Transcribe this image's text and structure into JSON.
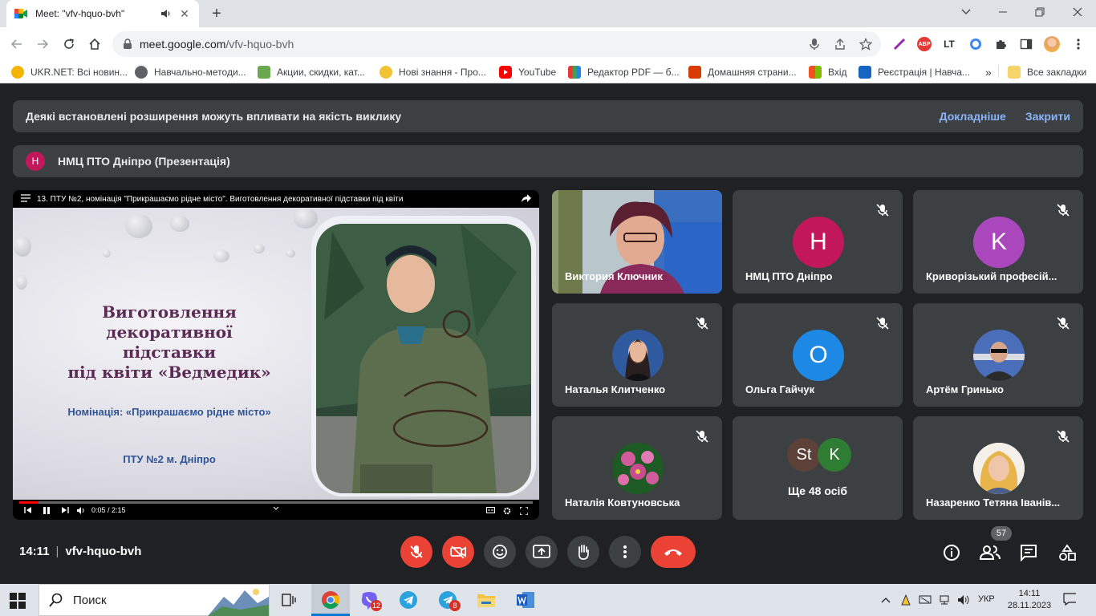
{
  "browser": {
    "tab_title": "Meet: \"vfv-hquo-bvh\"",
    "url_host": "meet.google.com",
    "url_path": "/vfv-hquo-bvh",
    "extensions": [
      "abp-badge-icon",
      "lt-icon",
      "circle-icon",
      "puzzle-icon",
      "sidepanel-icon",
      "profile-avatar"
    ],
    "abp_label": "ABP",
    "lt_label": "LT",
    "bookmarks": [
      {
        "label": "UKR.NET: Всі новин...",
        "icon": "sun-icon",
        "color": "#f4b400"
      },
      {
        "label": "Навчально-методи...",
        "icon": "globe-icon",
        "color": "#5f6368"
      },
      {
        "label": "Акции, скидки, кат...",
        "icon": "shop-icon",
        "color": "#6aa84f"
      },
      {
        "label": "Нові знання - Про...",
        "icon": "bulb-icon",
        "color": "#f1c232"
      },
      {
        "label": "YouTube",
        "icon": "youtube-icon",
        "color": "#ff0000"
      },
      {
        "label": "Редактор PDF — б...",
        "icon": "pdf-icon",
        "color": "#8e44ad"
      },
      {
        "label": "Домашняя страни...",
        "icon": "office-icon",
        "color": "#d83b01"
      },
      {
        "label": "Вхід",
        "icon": "windows-icon",
        "color": "#00a4ef"
      },
      {
        "label": "Реєстрація | Навча...",
        "icon": "eagle-icon",
        "color": "#1565c0"
      }
    ],
    "more_bookmarks": "»",
    "all_bookmarks": "Все закладки"
  },
  "meet": {
    "banner_text": "Деякі встановлені розширення можуть впливати на якість виклику",
    "banner_more": "Докладніше",
    "banner_close": "Закрити",
    "presenter_initial": "Н",
    "presenter_name": "НМЦ ПТО Дніпро (Презентація)",
    "video": {
      "title": "13. ПТУ №2, номінація \"Прикрашаємо рідне місто\". Виготовлення декоративної підставки під квіти",
      "slide_title_1": "Виготовлення декоративної",
      "slide_title_2": "підставки",
      "slide_title_3": "під квіти «Ведмедик»",
      "slide_nomination": "Номінація: «Прикрашаємо рідне місто»",
      "slide_school": "ПТУ №2 м. Дніпро",
      "time": "0:05 / 2:15",
      "progress": 0.037
    },
    "participants": [
      {
        "name": "Виктория Ключник",
        "type": "video",
        "muted": false
      },
      {
        "name": "НМЦ ПТО Дніпро",
        "initial": "Н",
        "color": "#c2185b",
        "muted": true
      },
      {
        "name": "Криворізький професій...",
        "initial": "K",
        "color": "#ab47bc",
        "muted": true
      },
      {
        "name": "Наталья Клитченко",
        "type": "photo",
        "muted": true
      },
      {
        "name": "Ольга Гайчук",
        "initial": "О",
        "color": "#1e88e5",
        "muted": true
      },
      {
        "name": "Артём Гринько",
        "type": "photo",
        "muted": true
      },
      {
        "name": "Наталія Ковтуновська",
        "type": "photo",
        "muted": true
      },
      {
        "name": "Ще 48 осіб",
        "type": "group",
        "initials": [
          "St",
          "K"
        ],
        "muted": false
      },
      {
        "name": "Назаренко Тетяна Іванів...",
        "type": "photo",
        "muted": true
      }
    ],
    "time": "14:11",
    "separator": "|",
    "code": "vfv-hquo-bvh",
    "people_count": "57"
  },
  "taskbar": {
    "search_text": "Поиск",
    "viber_badge": "12",
    "telegram_badge": "8",
    "lang": "УКР",
    "time": "14:11",
    "date": "28.11.2023"
  }
}
